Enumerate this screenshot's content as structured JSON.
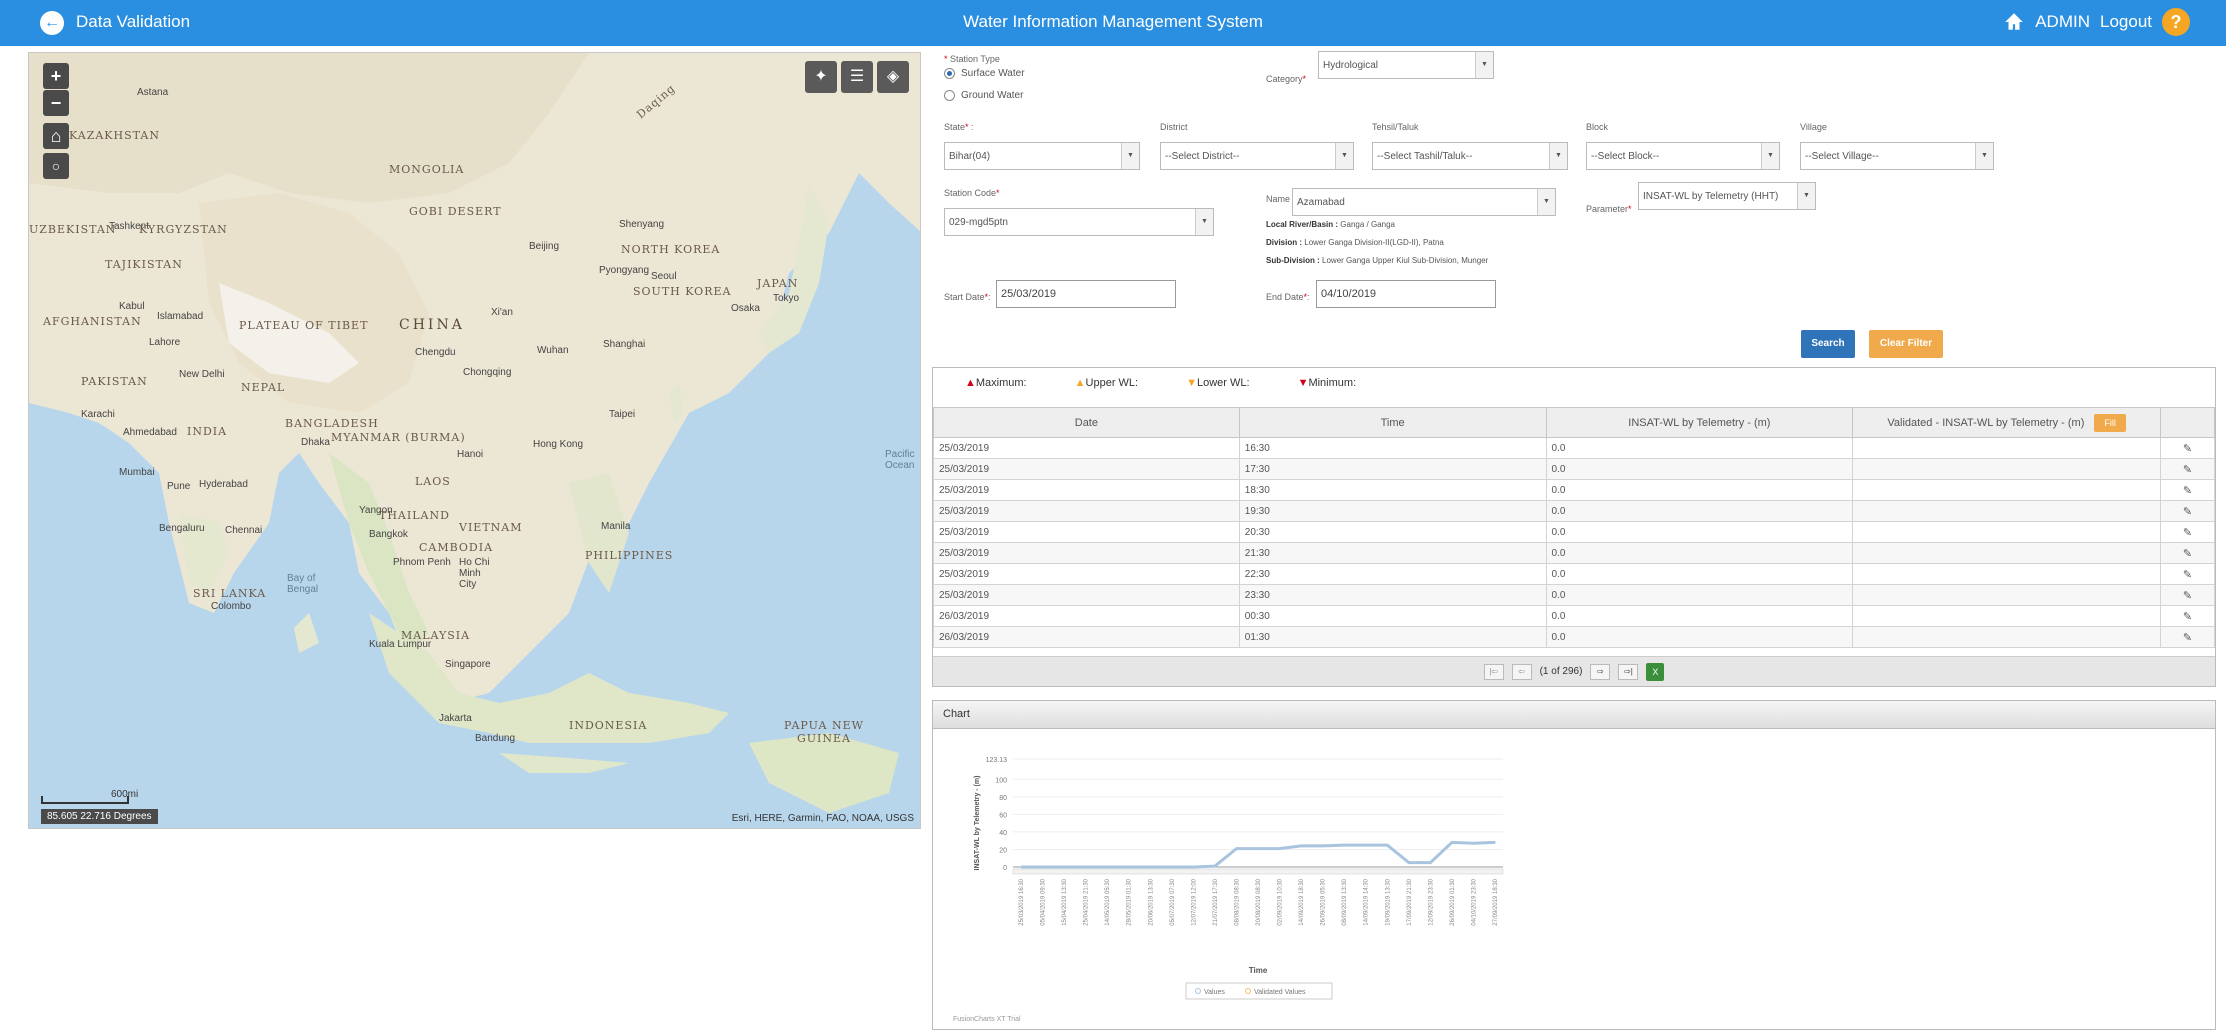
{
  "header": {
    "back_title": "Data Validation",
    "app_title": "Water Information Management System",
    "user": "ADMIN",
    "logout": "Logout",
    "help": "?"
  },
  "map": {
    "labels": [
      "Astana",
      "KAZAKHSTAN",
      "MONGOLIA",
      "GOBI DESERT",
      "UZBEKISTAN",
      "Tashkent",
      "KYRGYZSTAN",
      "TAJIKISTAN",
      "Kabul",
      "Islamabad",
      "AFGHANISTAN",
      "Lahore",
      "PLATEAU OF TIBET",
      "CHINA",
      "PAKISTAN",
      "New Delhi",
      "NEPAL",
      "Karachi",
      "Ahmedabad",
      "INDIA",
      "BANGLADESH",
      "MYANMAR (BURMA)",
      "Mumbai",
      "Pune",
      "Hyderabad",
      "Bengaluru",
      "Chennai",
      "SRI LANKA",
      "Colombo",
      "LAOS",
      "Yangon",
      "THAILAND",
      "Bangkok",
      "VIETNAM",
      "CAMBODIA",
      "Phnom Penh",
      "Ho Chi Minh City",
      "MALAYSIA",
      "Kuala Lumpur",
      "Singapore",
      "Jakarta",
      "Bandung",
      "INDONESIA",
      "PHILIPPINES",
      "Manila",
      "Hong Kong",
      "Hanoi",
      "Taipei",
      "Shanghai",
      "Wuhan",
      "Chongqing",
      "Chengdu",
      "Xi'an",
      "Beijing",
      "Shenyang",
      "NORTH KOREA",
      "Pyongyang",
      "Seoul",
      "SOUTH KOREA",
      "Osaka",
      "Tokyo",
      "JAPAN",
      "Daqing",
      "PAPUA NEW GUINEA",
      "Pacific Ocean",
      "Bay of Bengal",
      "Dhaka"
    ],
    "scale_label": "600mi",
    "coords": "85.605 22.716 Degrees",
    "attribution": "Esri, HERE, Garmin, FAO, NOAA, USGS"
  },
  "form": {
    "station_type_label": "Station Type",
    "station_types": [
      "Surface Water",
      "Ground Water"
    ],
    "station_type_selected": "Surface Water",
    "category_label": "Category",
    "category_value": "Hydrological",
    "state_label": "State",
    "state_value": "Bihar(04)",
    "district_label": "District",
    "district_value": "--Select District--",
    "tehsil_label": "Tehsil/Taluk",
    "tehsil_value": "--Select Tashil/Taluk--",
    "block_label": "Block",
    "block_value": "--Select Block--",
    "village_label": "Village",
    "village_value": "--Select Village--",
    "station_code_label": "Station Code",
    "station_code_value": "029-mgd5ptn",
    "name_label": "Name",
    "name_value": "Azamabad",
    "parameter_label": "Parameter",
    "parameter_value": "INSAT-WL by Telemetry (HHT)",
    "local_river_label": "Local River/Basin :",
    "local_river_value": "Ganga / Ganga",
    "division_label": "Division :",
    "division_value": "Lower Ganga Division-II(LGD-II), Patna",
    "subdivision_label": "Sub-Division :",
    "subdivision_value": "Lower Ganga Upper Kiul Sub-Division, Munger",
    "start_date_label": "Start Date",
    "start_date_value": "25/03/2019",
    "end_date_label": "End Date",
    "end_date_value": "04/10/2019",
    "search_label": "Search",
    "clear_label": "Clear Filter"
  },
  "legend": {
    "maximum": "Maximum:",
    "upper": "Upper WL:",
    "lower": "Lower WL:",
    "minimum": "Minimum:"
  },
  "table": {
    "columns": [
      "Date",
      "Time",
      "INSAT-WL by Telemetry - (m)",
      "Validated - INSAT-WL by Telemetry - (m)"
    ],
    "fill_label": "Fill",
    "rows": [
      {
        "date": "25/03/2019",
        "time": "16:30",
        "value": "0.0"
      },
      {
        "date": "25/03/2019",
        "time": "17:30",
        "value": "0.0"
      },
      {
        "date": "25/03/2019",
        "time": "18:30",
        "value": "0.0"
      },
      {
        "date": "25/03/2019",
        "time": "19:30",
        "value": "0.0"
      },
      {
        "date": "25/03/2019",
        "time": "20:30",
        "value": "0.0"
      },
      {
        "date": "25/03/2019",
        "time": "21:30",
        "value": "0.0"
      },
      {
        "date": "25/03/2019",
        "time": "22:30",
        "value": "0.0"
      },
      {
        "date": "25/03/2019",
        "time": "23:30",
        "value": "0.0"
      },
      {
        "date": "26/03/2019",
        "time": "00:30",
        "value": "0.0"
      },
      {
        "date": "26/03/2019",
        "time": "01:30",
        "value": "0.0"
      }
    ],
    "pager_text": "(1 of 296)"
  },
  "chart_panel": {
    "title": "Chart",
    "credit": "FusionCharts XT Trial"
  },
  "chart_data": {
    "type": "line",
    "xlabel": "Time",
    "ylabel": "INSAT-WL by Telemetry - (m)",
    "ylim": [
      0,
      123.13
    ],
    "yticks": [
      "123.13",
      "100",
      "80",
      "60",
      "40",
      "20",
      "0"
    ],
    "categories": [
      "25/03/2019 16:30",
      "05/04/2019 09:30",
      "15/04/2019 13:30",
      "25/04/2019 21:30",
      "14/05/2019 05:30",
      "28/05/2019 01:30",
      "20/06/2019 13:30",
      "05/07/2019 07:30",
      "12/07/2019 12:00",
      "21/07/2019 17:30",
      "08/08/2019 08:30",
      "20/08/2019 08:30",
      "02/09/2019 10:30",
      "14/09/2019 18:30",
      "26/09/2019 05:30",
      "08/09/2019 13:30",
      "14/09/2019 14:30",
      "19/09/2019 13:30",
      "17/09/2019 21:30",
      "12/09/2019 23:30",
      "26/09/2019 01:30",
      "04/10/2019 23:30",
      "27/09/2019 18:30"
    ],
    "series": [
      {
        "name": "Values",
        "color": "#a9c4df",
        "values": [
          0,
          0,
          0,
          0,
          0,
          0,
          0,
          0,
          0,
          1,
          21,
          21,
          21,
          24,
          24,
          25,
          25,
          25,
          5,
          5,
          28,
          27,
          28
        ]
      },
      {
        "name": "Validated Values",
        "color": "#f0c060",
        "values": []
      }
    ],
    "legend": "bottom"
  }
}
